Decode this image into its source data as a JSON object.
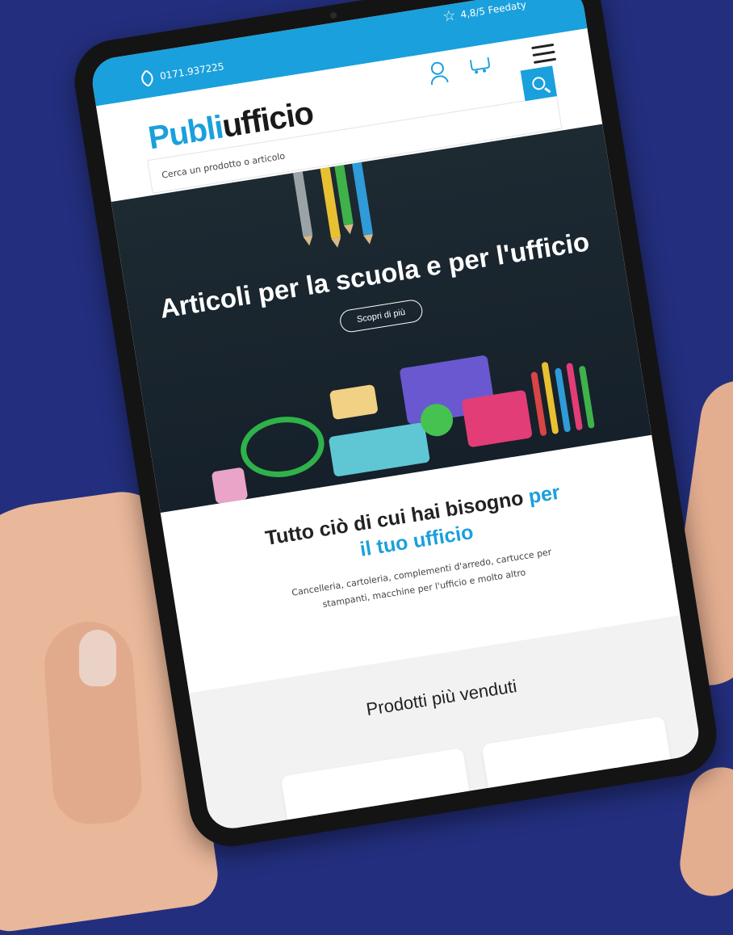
{
  "topbar": {
    "phone": "0171.937225",
    "rating": "4,8/5 Feedaty"
  },
  "header": {
    "logo_part1": "Publi",
    "logo_part2": "ufficio",
    "search_placeholder": "Cerca un prodotto o articolo"
  },
  "hero": {
    "title": "Articoli per la scuola e per l'ufficio",
    "button_label": "Scopri di più"
  },
  "intro": {
    "title_main": "Tutto ciò di cui hai bisogno",
    "title_highlight_1": "per",
    "title_highlight_2": "il tuo ufficio",
    "subtitle_line1": "Cancelleria, cartoleria, complementi d'arredo, cartucce per",
    "subtitle_line2": "stampanti, macchine per l'ufficio e molto altro"
  },
  "bestsellers": {
    "title": "Prodotti più venduti"
  },
  "colors": {
    "accent": "#1aa0dc",
    "background": "#232f7e",
    "hero_bg": "#1e2a32"
  },
  "icons": [
    "phone-icon",
    "star-icon",
    "user-icon",
    "cart-icon",
    "menu-icon",
    "search-icon"
  ]
}
